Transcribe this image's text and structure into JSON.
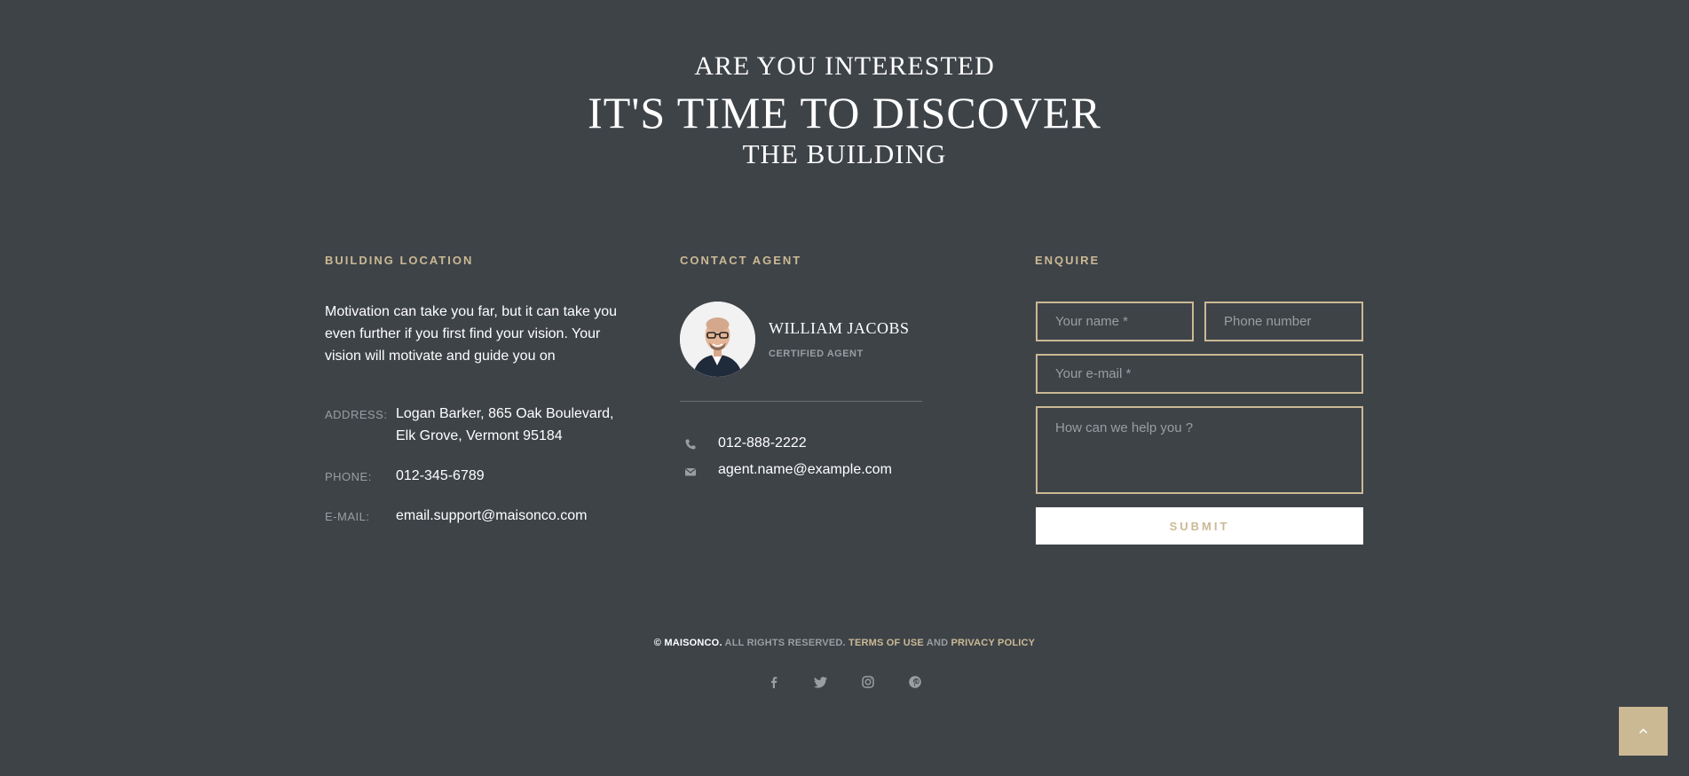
{
  "hero": {
    "line1": "Are you interested",
    "line2": "It's time to discover",
    "line3": "the building"
  },
  "location": {
    "title": "Building location",
    "description": "Motivation can take you far, but it can take you even further if you first find your vision. Your vision will motivate and guide you on",
    "address_label": "Address:",
    "address_line1": "Logan Barker, 865 Oak Boulevard,",
    "address_line2": "Elk Grove, Vermont 95184",
    "phone_label": "Phone:",
    "phone_value": "012-345-6789",
    "email_label": "E-mail:",
    "email_value": "email.support@maisonco.com"
  },
  "agent": {
    "title": "Contact agent",
    "name": "William Jacobs",
    "role": "Certified agent",
    "phone": "012-888-2222",
    "email": "agent.name@example.com",
    "phone_icon": "phone-icon",
    "email_icon": "envelope-icon"
  },
  "enquire": {
    "title": "Enquire",
    "name_placeholder": "Your name *",
    "phone_placeholder": "Phone number",
    "email_placeholder": "Your e-mail *",
    "message_placeholder": "How can we help you ?",
    "submit_label": "Submit"
  },
  "footer": {
    "copyright": "© MAISONCO.",
    "rights": " ALL RIGHTS RESERVED. ",
    "terms": "TERMS OF USE",
    "and": " AND ",
    "privacy": "PRIVACY POLICY",
    "social": [
      "facebook-icon",
      "twitter-icon",
      "instagram-icon",
      "pinterest-icon"
    ]
  },
  "colors": {
    "background": "#3e4348",
    "accent": "#cbb994",
    "muted": "#9a9ea2"
  }
}
